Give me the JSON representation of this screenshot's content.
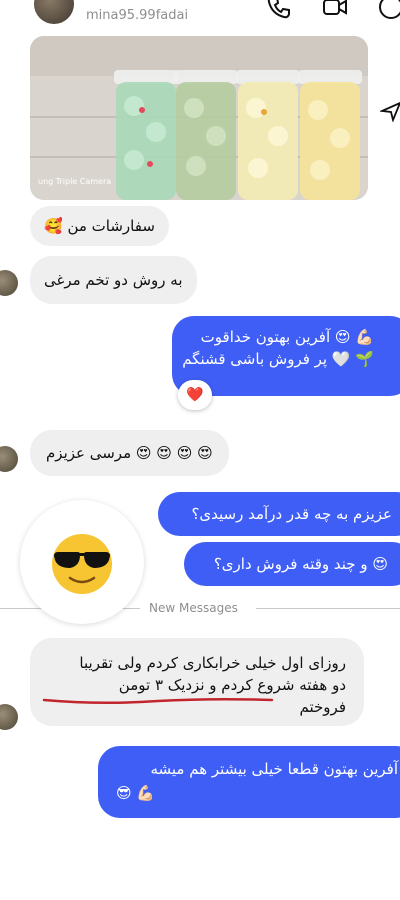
{
  "header": {
    "contact_name": "mina",
    "username": "mina95.99fadai",
    "icons": [
      "phone-icon",
      "video-camera-icon",
      "info-icon"
    ]
  },
  "photo": {
    "caption": "ung Triple Camera",
    "jars": [
      "#a8d8b8",
      "#b5cca0",
      "#f3ebb4",
      "#f4e39a"
    ]
  },
  "messages": {
    "m1": "سفارشات من 🥰",
    "m2": "به روش دو تخم مرغی",
    "m3_line1": "💪🏻 😍 آفرین بهتون خداقوت",
    "m3_line2": "🌱 🤍 پر فروش باشی قشنگم",
    "reaction": "❤️",
    "m4": "😍 😍 😍 😍 مرسی عزیزم",
    "m5": "عزیزم به چه قدر درآمد رسیدی؟",
    "m6": "😍 و چند وقته فروش داری؟",
    "new_messages": "New Messages",
    "m7_line1": "روزای اول خیلی خرابکاری کردم ولی تقریبا",
    "m7_line2": "دو هفته شروع کردم و نزدیک ۳ تومن",
    "m7_line3": "فروختم",
    "m8_line1": "آفرین بهتون قطعا خیلی بیشتر هم میشه",
    "m8_line2": "😎 💪🏻"
  },
  "colors": {
    "sent_bubble": "#3f5ef5",
    "received_bubble": "#efefef",
    "underline": "#c0262c"
  }
}
